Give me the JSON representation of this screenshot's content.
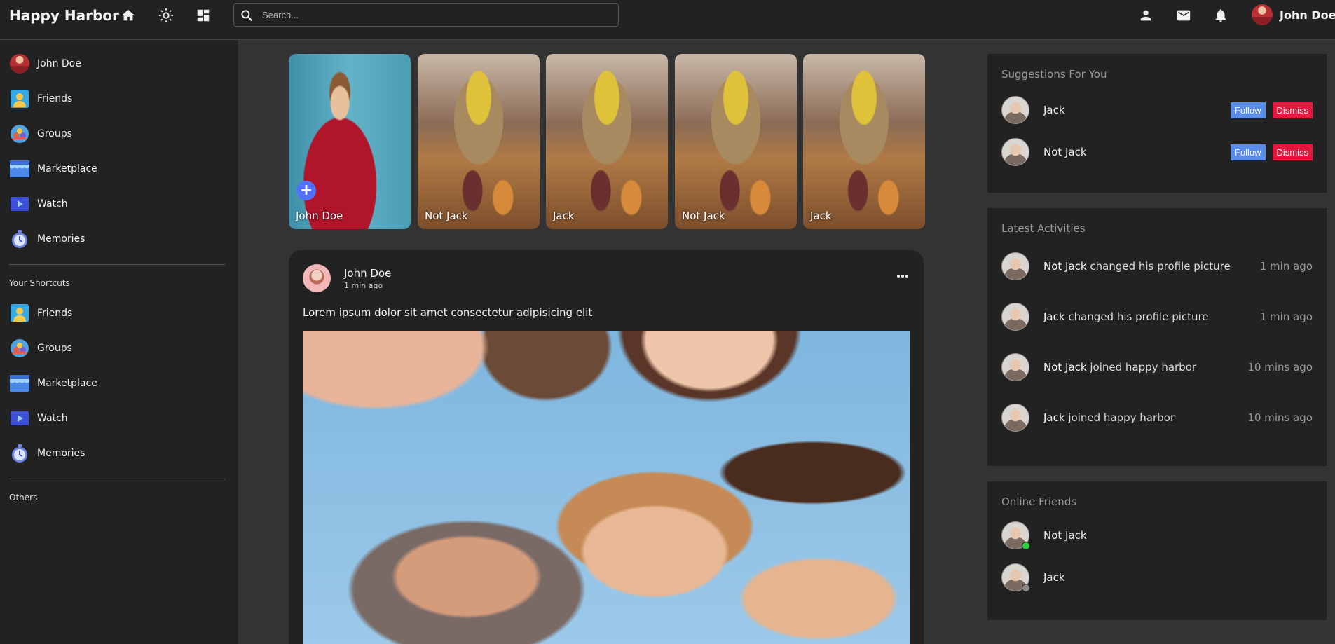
{
  "app": {
    "logo": "Happy Harbor"
  },
  "navbar": {
    "icons": [
      "home-icon",
      "theme-toggle-icon",
      "grid-icon",
      "person-icon",
      "mail-icon",
      "bell-icon"
    ],
    "search": {
      "placeholder": "Search...",
      "value": ""
    },
    "user": {
      "name": "John Doe"
    }
  },
  "sidebar": {
    "main_items": [
      {
        "label": "John Doe",
        "icon": "user-avatar"
      },
      {
        "label": "Friends",
        "icon": "friends-icon"
      },
      {
        "label": "Groups",
        "icon": "groups-icon"
      },
      {
        "label": "Marketplace",
        "icon": "marketplace-icon"
      },
      {
        "label": "Watch",
        "icon": "watch-icon"
      },
      {
        "label": "Memories",
        "icon": "memories-icon"
      }
    ],
    "shortcuts_title": "Your Shortcuts",
    "shortcut_items": [
      {
        "label": "Friends",
        "icon": "friends-icon"
      },
      {
        "label": "Groups",
        "icon": "groups-icon"
      },
      {
        "label": "Marketplace",
        "icon": "marketplace-icon"
      },
      {
        "label": "Watch",
        "icon": "watch-icon"
      },
      {
        "label": "Memories",
        "icon": "memories-icon"
      }
    ],
    "others_title": "Others"
  },
  "stories": [
    {
      "name": "John Doe",
      "add": "+"
    },
    {
      "name": "Not Jack"
    },
    {
      "name": "Jack"
    },
    {
      "name": "Not Jack"
    },
    {
      "name": "Jack"
    }
  ],
  "post": {
    "author": "John Doe",
    "time": "1 min ago",
    "text": "Lorem ipsum dolor sit amet consectetur adipisicing elit"
  },
  "suggestions": {
    "title": "Suggestions For You",
    "follow_label": "Follow",
    "dismiss_label": "Dismiss",
    "items": [
      {
        "name": "Jack"
      },
      {
        "name": "Not Jack"
      }
    ]
  },
  "activities": {
    "title": "Latest Activities",
    "items": [
      {
        "name": "Not Jack",
        "action": "changed his profile picture",
        "time": "1 min ago"
      },
      {
        "name": "Jack",
        "action": "changed his profile picture",
        "time": "1 min ago"
      },
      {
        "name": "Not Jack",
        "action": "joined happy harbor",
        "time": "10 mins ago"
      },
      {
        "name": "Jack",
        "action": "joined happy harbor",
        "time": "10 mins ago"
      }
    ]
  },
  "online": {
    "title": "Online Friends",
    "items": [
      {
        "name": "Not Jack",
        "status": "online",
        "color": "#2ecc40"
      },
      {
        "name": "Jack",
        "status": "offline",
        "color": "#8a8a8a"
      }
    ]
  },
  "colors": {
    "accent": "#5271ff",
    "follow": "#5a8de8",
    "dismiss": "#e8173f",
    "online": "#2ecc40"
  }
}
